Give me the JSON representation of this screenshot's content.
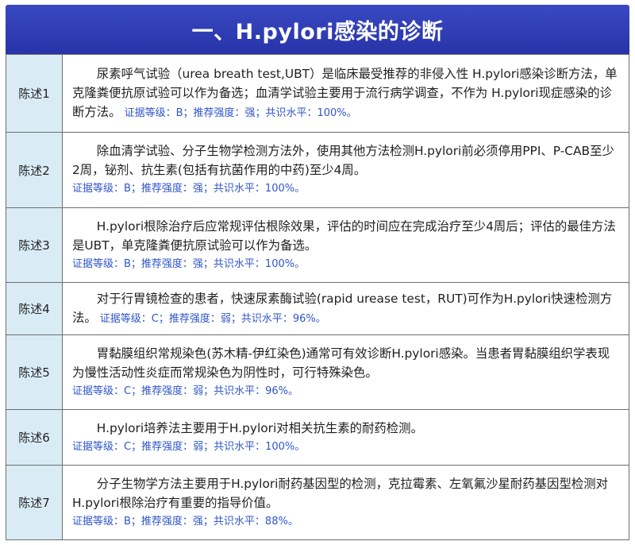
{
  "title": "一、H.pylori感染的诊断",
  "rows": [
    {
      "label": "陈述1",
      "text": "尿素呼气试验（urea breath test,UBT）是临床最受推荐的非侵入性 H.pylori感染诊断方法，单克隆粪便抗原试验可以作为备选；血清学试验主要用于流行病学调查，不作为 H.pylori现症感染的诊断方法。",
      "evidence": "证据等级：B；推荐强度：强；共识水平：100%。"
    },
    {
      "label": "陈述2",
      "text": "除血清学试验、分子生物学检测方法外，使用其他方法检测H.pylori前必须停用PPI、P-CAB至少2周，铋剂、抗生素(包括有抗菌作用的中药)至少4周。",
      "evidence": "证据等级：B；推荐强度：强；共识水平：100%。"
    },
    {
      "label": "陈述3",
      "text": "H.pylori根除治疗后应常规评估根除效果，评估的时间应在完成治疗至少4周后；评估的最佳方法是UBT，单克隆粪便抗原试验可以作为备选。",
      "evidence": "证据等级：B；推荐强度：强；共识水平：100%。"
    },
    {
      "label": "陈述4",
      "text": "对于行胃镜检查的患者，快速尿素酶试验(rapid urease test，RUT)可作为H.pylori快速检测方法。",
      "evidence": "证据等级：C；推荐强度：弱；共识水平：96%。"
    },
    {
      "label": "陈述5",
      "text": "胃黏膜组织常规染色(苏木精-伊红染色)通常可有效诊断H.pylori感染。当患者胃黏膜组织学表现为慢性活动性炎症而常规染色为阴性时，可行特殊染色。",
      "evidence": "证据等级：C；推荐强度：弱；共识水平：96%。"
    },
    {
      "label": "陈述6",
      "text": "H.pylori培养法主要用于H.pylori对相关抗生素的耐药检测。",
      "evidence": "证据等级：C；推荐强度：弱；共识水平：100%。"
    },
    {
      "label": "陈述7",
      "text": "分子生物学方法主要用于H.pylori耐药基因型的检测，克拉霉素、左氧氟沙星耐药基因型检测对H.pylori根除治疗有重要的指导价值。",
      "evidence": "证据等级：B；推荐强度：强；共识水平：88%。"
    }
  ]
}
